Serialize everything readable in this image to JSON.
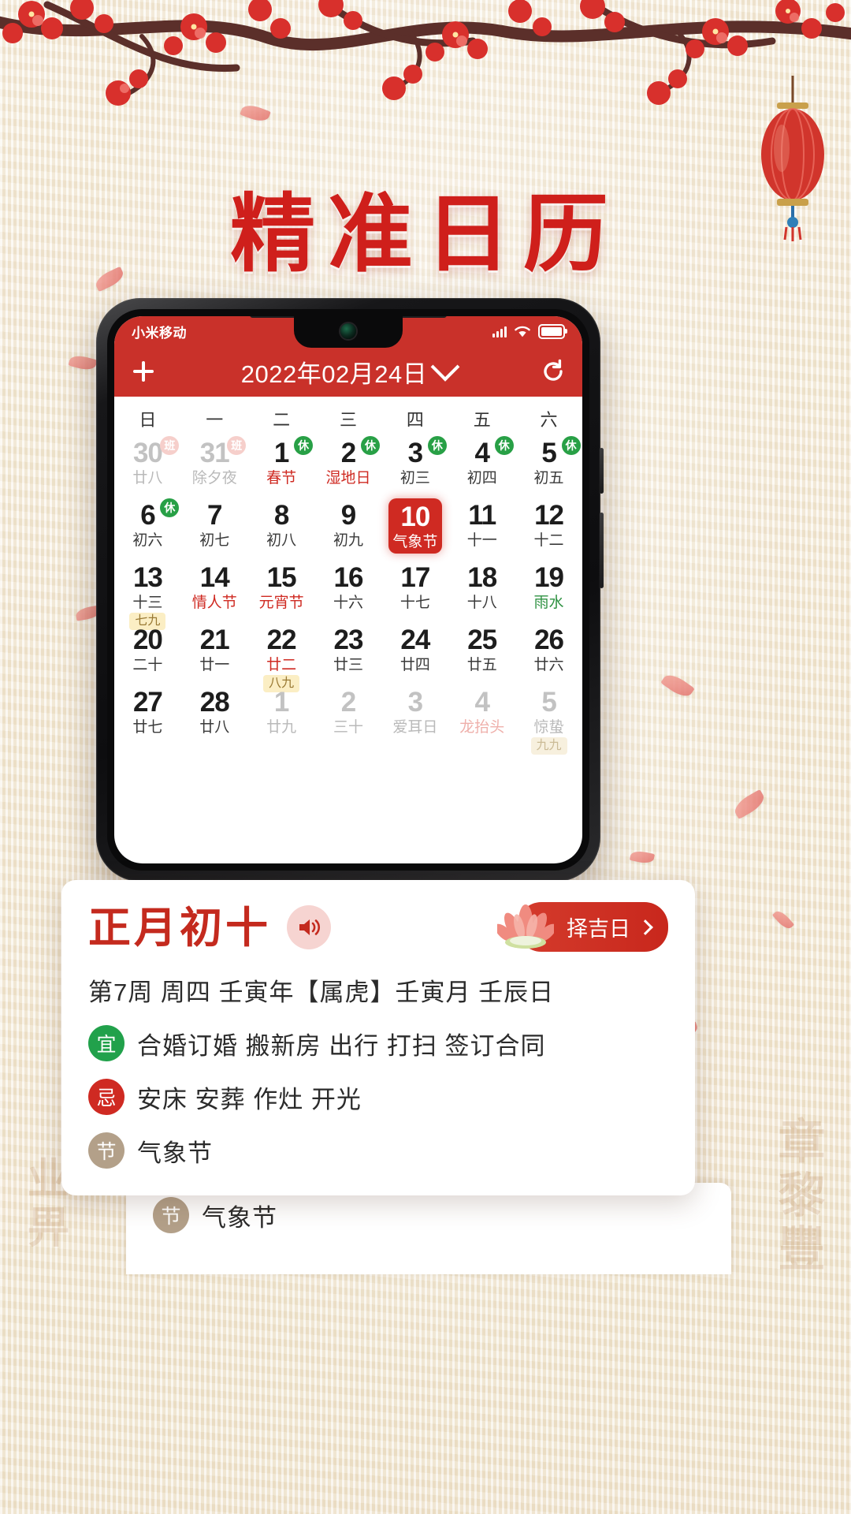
{
  "poster": {
    "title": "精准日历",
    "calligraphy_left": "业畀",
    "calligraphy_right": "章黎豐"
  },
  "phone": {
    "statusbar": {
      "carrier": "小米移动",
      "signal_icon": "signal-bars-icon",
      "wifi_icon": "wifi-icon",
      "battery_icon": "battery-full-icon"
    },
    "appbar": {
      "add_icon": "plus-icon",
      "title": "2022年02月24日",
      "dropdown_icon": "chevron-down-icon",
      "refresh_icon": "refresh-icon"
    },
    "calendar": {
      "weekdays": [
        "日",
        "一",
        "二",
        "三",
        "四",
        "五",
        "六"
      ],
      "selected_day": 10,
      "weeks": [
        [
          {
            "day": "30",
            "lunar": "廿八",
            "other": true,
            "badge": "班"
          },
          {
            "day": "31",
            "lunar": "除夕夜",
            "other": true,
            "badge": "班"
          },
          {
            "day": "1",
            "lunar": "春节",
            "fest": true,
            "badge": "休"
          },
          {
            "day": "2",
            "lunar": "湿地日",
            "fest": true,
            "badge": "休"
          },
          {
            "day": "3",
            "lunar": "初三",
            "badge": "休"
          },
          {
            "day": "4",
            "lunar": "初四",
            "badge": "休"
          },
          {
            "day": "5",
            "lunar": "初五",
            "badge": "休"
          }
        ],
        [
          {
            "day": "6",
            "lunar": "初六",
            "badge": "休"
          },
          {
            "day": "7",
            "lunar": "初七"
          },
          {
            "day": "8",
            "lunar": "初八"
          },
          {
            "day": "9",
            "lunar": "初九"
          },
          {
            "day": "10",
            "lunar": "气象节",
            "selected": true
          },
          {
            "day": "11",
            "lunar": "十一"
          },
          {
            "day": "12",
            "lunar": "十二"
          }
        ],
        [
          {
            "day": "13",
            "lunar": "十三",
            "nine": "七九"
          },
          {
            "day": "14",
            "lunar": "情人节",
            "fest": true
          },
          {
            "day": "15",
            "lunar": "元宵节",
            "fest": true
          },
          {
            "day": "16",
            "lunar": "十六"
          },
          {
            "day": "17",
            "lunar": "十七"
          },
          {
            "day": "18",
            "lunar": "十八"
          },
          {
            "day": "19",
            "lunar": "雨水",
            "term": true
          }
        ],
        [
          {
            "day": "20",
            "lunar": "二十"
          },
          {
            "day": "21",
            "lunar": "廿一"
          },
          {
            "day": "22",
            "lunar": "廿二",
            "fest": true,
            "nine": "八九"
          },
          {
            "day": "23",
            "lunar": "廿三"
          },
          {
            "day": "24",
            "lunar": "廿四"
          },
          {
            "day": "25",
            "lunar": "廿五"
          },
          {
            "day": "26",
            "lunar": "廿六"
          }
        ],
        [
          {
            "day": "27",
            "lunar": "廿七"
          },
          {
            "day": "28",
            "lunar": "廿八"
          },
          {
            "day": "1",
            "lunar": "廿九",
            "other": true
          },
          {
            "day": "2",
            "lunar": "三十",
            "other": true
          },
          {
            "day": "3",
            "lunar": "爱耳日",
            "other": true
          },
          {
            "day": "4",
            "lunar": "龙抬头",
            "other": true,
            "fest": true
          },
          {
            "day": "5",
            "lunar": "惊蛰",
            "other": true,
            "nine": "九九"
          }
        ]
      ]
    }
  },
  "info_card": {
    "lunar_date": "正月初十",
    "speaker_icon": "speaker-icon",
    "lucky_label": "择吉日",
    "lucky_icon": "lotus-icon",
    "lucky_chevron_icon": "chevron-right-icon",
    "meta": "第7周 周四 壬寅年【属虎】壬寅月 壬辰日",
    "rows": [
      {
        "chip": "宜",
        "type": "yi",
        "text": "合婚订婚 搬新房 出行 打扫 签订合同"
      },
      {
        "chip": "忌",
        "type": "ji",
        "text": "安床 安葬 作灶 开光"
      },
      {
        "chip": "节",
        "type": "jie",
        "text": "气象节"
      }
    ]
  },
  "ghost_card": {
    "chip": "节",
    "text": "气象节"
  },
  "colors": {
    "brand_red": "#c9312a",
    "selected_red": "#cf2a22",
    "festival_red": "#cf2a22",
    "term_green": "#2e9141",
    "rest_badge_green": "#28a046",
    "work_badge_pink": "#f6cfcb",
    "nine_badge_bg": "#fbeec4",
    "title_red": "#cf1f1b"
  }
}
